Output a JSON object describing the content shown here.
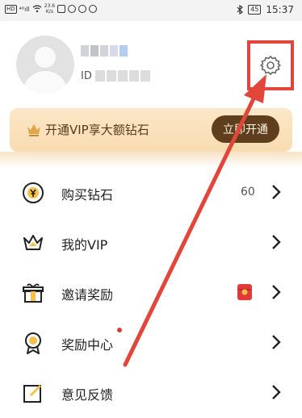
{
  "status_bar": {
    "hd": "HD",
    "signal": "⁴⁶ıll",
    "speed": "23.6\nK/s",
    "battery": "45",
    "time": "15:37"
  },
  "profile": {
    "id_label": "ID"
  },
  "vip_banner": {
    "text": "开通VIP享大额钻石",
    "button": "立即开通"
  },
  "menu": [
    {
      "label": "购买钻石",
      "count": "60"
    },
    {
      "label": "我的VIP"
    },
    {
      "label": "邀请奖励"
    },
    {
      "label": "奖励中心"
    },
    {
      "label": "意见反馈"
    }
  ],
  "colors": {
    "accent_brown": "#5f3e1d",
    "banner_gold": "#fbe7c7",
    "highlight_red": "#e2463a"
  }
}
